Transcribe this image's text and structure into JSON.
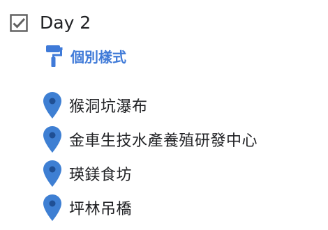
{
  "layer": {
    "title": "Day 2",
    "checked": true,
    "checkbox_icon": "checkbox-checked-icon"
  },
  "style": {
    "label": "個別樣式",
    "icon": "paint-roller-icon",
    "color": "#3f7ad8"
  },
  "places": [
    {
      "label": "猴洞坑瀑布",
      "icon": "map-pin-icon"
    },
    {
      "label": "金車生技水產養殖研發中心",
      "icon": "map-pin-icon"
    },
    {
      "label": "瑛鎂食坊",
      "icon": "map-pin-icon"
    },
    {
      "label": "坪林吊橋",
      "icon": "map-pin-icon"
    }
  ],
  "colors": {
    "pin": "#3e7fd3",
    "pin_dot": "#1f4f94",
    "text": "#202124",
    "checkbox": "#616161"
  }
}
